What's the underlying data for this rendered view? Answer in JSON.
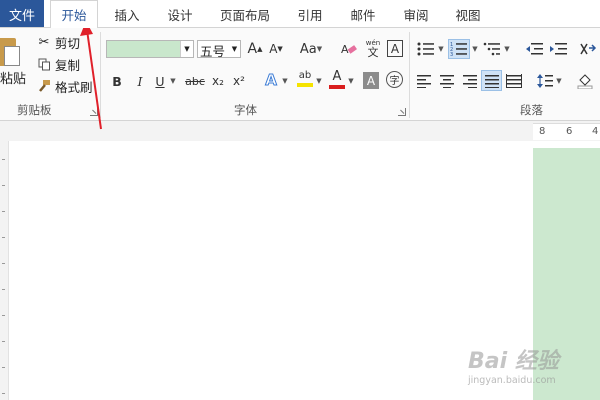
{
  "tabs": [
    {
      "label": "文件",
      "active": false
    },
    {
      "label": "开始",
      "active": true
    },
    {
      "label": "插入",
      "active": false
    },
    {
      "label": "设计",
      "active": false
    },
    {
      "label": "页面布局",
      "active": false
    },
    {
      "label": "引用",
      "active": false
    },
    {
      "label": "邮件",
      "active": false
    },
    {
      "label": "审阅",
      "active": false
    },
    {
      "label": "视图",
      "active": false
    }
  ],
  "clipboard": {
    "paste_label": "粘贴",
    "cut_label": "剪切",
    "copy_label": "复制",
    "format_painter_label": "格式刷",
    "group_label": "剪贴板"
  },
  "font": {
    "font_name": "",
    "font_size": "五号",
    "group_label": "字体",
    "bold": "B",
    "italic": "I",
    "underline": "U",
    "strike": "abc",
    "subscript": "x₂",
    "superscript": "x²",
    "grow": "A",
    "shrink": "A",
    "case": "Aa",
    "phonetic_top": "wén",
    "phonetic_bottom": "文",
    "border_char": "A",
    "text_effect": "A",
    "highlight": "ab",
    "font_color": "A",
    "shading": "A",
    "enclose": "字"
  },
  "paragraph": {
    "group_label": "段落"
  },
  "ruler": {
    "numbers": [
      "8",
      "6",
      "4"
    ]
  },
  "watermark": {
    "logo": "Bai 经验",
    "url": "jingyan.baidu.com"
  },
  "colors": {
    "file_tab": "#2b579a",
    "active_tab_text": "#2b579a",
    "annotation_arrow": "#e0202a",
    "highlight_green": "#c9e7cc",
    "font_color_red": "#d91e1e",
    "highlight_yellow": "#f5e300"
  }
}
